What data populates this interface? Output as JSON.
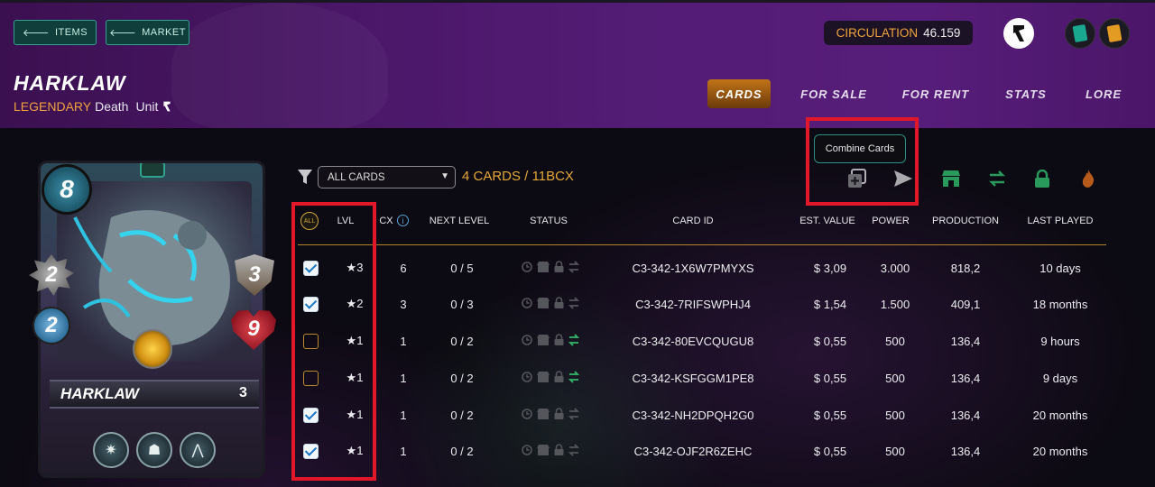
{
  "nav": {
    "items_label": "ITEMS",
    "market_label": "MARKET"
  },
  "circulation": {
    "label": "CIRCULATION",
    "value": "46.159"
  },
  "card": {
    "title": "HARKLAW",
    "rarity": "LEGENDARY",
    "element": "Death",
    "kind": "Unit",
    "mana": "8",
    "melee": "2",
    "speed": "2",
    "armor": "3",
    "health": "9",
    "name_on_card": "HARKLAW",
    "level_on_card": "3"
  },
  "tabs": [
    {
      "label": "CARDS",
      "active": true
    },
    {
      "label": "FOR SALE",
      "active": false
    },
    {
      "label": "FOR RENT",
      "active": false
    },
    {
      "label": "STATS",
      "active": false
    },
    {
      "label": "LORE",
      "active": false
    }
  ],
  "filter": {
    "selected": "ALL CARDS",
    "count_text": "4 CARDS / 11BCX"
  },
  "tooltip": "Combine Cards",
  "colors": {
    "accent": "#f0a23c",
    "header": "#531c75",
    "teal": "#2fa18d",
    "highlight": "#e2182a"
  },
  "table": {
    "all_label": "ALL",
    "headers": {
      "lvl": "LVL",
      "bcx": "CX",
      "next_level": "NEXT LEVEL",
      "status": "STATUS",
      "card_id": "CARD ID",
      "est_value": "EST. VALUE",
      "power": "POWER",
      "production": "PRODUCTION",
      "last_played": "LAST PLAYED"
    },
    "rows": [
      {
        "checked": true,
        "lvl": "★3",
        "bcx": "6",
        "next": "0 / 5",
        "card_id": "C3-342-1X6W7PMYXS",
        "value": "$ 3,09",
        "power": "3.000",
        "production": "818,2",
        "last": "10 days"
      },
      {
        "checked": true,
        "lvl": "★2",
        "bcx": "3",
        "next": "0 / 3",
        "card_id": "C3-342-7RIFSWPHJ4",
        "value": "$ 1,54",
        "power": "1.500",
        "production": "409,1",
        "last": "18 months"
      },
      {
        "checked": false,
        "lvl": "★1",
        "bcx": "1",
        "next": "0 / 2",
        "card_id": "C3-342-80EVCQUGU8",
        "value": "$ 0,55",
        "power": "500",
        "production": "136,4",
        "last": "9 hours"
      },
      {
        "checked": false,
        "lvl": "★1",
        "bcx": "1",
        "next": "0 / 2",
        "card_id": "C3-342-KSFGGM1PE8",
        "value": "$ 0,55",
        "power": "500",
        "production": "136,4",
        "last": "9 days"
      },
      {
        "checked": true,
        "lvl": "★1",
        "bcx": "1",
        "next": "0 / 2",
        "card_id": "C3-342-NH2DPQH2G0",
        "value": "$ 0,55",
        "power": "500",
        "production": "136,4",
        "last": "20 months"
      },
      {
        "checked": true,
        "lvl": "★1",
        "bcx": "1",
        "next": "0 / 2",
        "card_id": "C3-342-OJF2R6ZEHC",
        "value": "$ 0,55",
        "power": "500",
        "production": "136,4",
        "last": "20 months"
      }
    ]
  }
}
